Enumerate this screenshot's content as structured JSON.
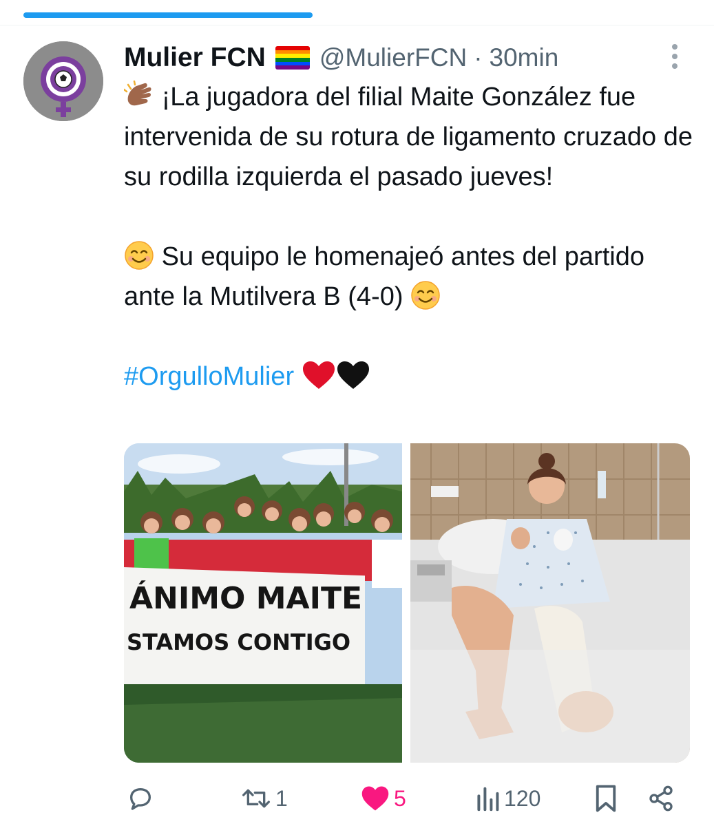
{
  "tweet": {
    "author": {
      "display_name": "Mulier FCN",
      "handle": "@MulierFCN",
      "separator": "·",
      "time": "30min"
    },
    "text": {
      "paragraph1": "¡La jugadora del filial Maite González fue intervenida de su rotura de ligamento cruzado de su rodilla izquierda el pasado jueves!",
      "paragraph2": "Su equipo le homenajeó antes del partido ante la Mutilvera B (4-0)",
      "hashtag": "#OrgulloMulier"
    },
    "media": {
      "banner_line1": "ÁNIMO MAITE",
      "banner_line2": "STAMOS CONTIGO"
    },
    "actions": {
      "reply_count": "",
      "retweet_count": "1",
      "like_count": "5",
      "views_count": "120"
    }
  },
  "colors": {
    "accent": "#1d9bf0",
    "like": "#f91880",
    "muted": "#536471"
  },
  "icons": [
    "rainbow-flag-icon",
    "clapping-hands-icon",
    "smiling-face-icon",
    "red-heart-icon",
    "black-heart-icon",
    "reply-icon",
    "retweet-icon",
    "like-icon",
    "views-icon",
    "bookmark-icon",
    "share-icon",
    "more-icon"
  ]
}
